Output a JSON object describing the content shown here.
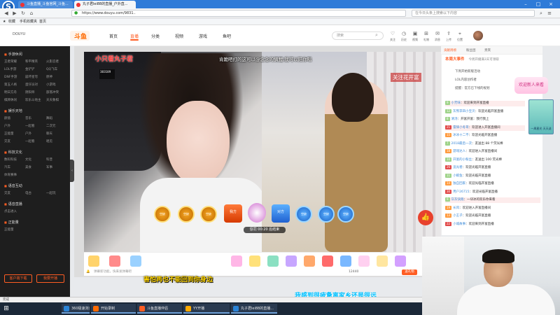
{
  "browser": {
    "tabs": [
      {
        "label": "斗鱼直播_斗鱼官网_斗鱼..."
      },
      {
        "label": "丸子君lei88的直播_户外直..."
      }
    ],
    "url": "https://www.douyu.com/9831..",
    "search_placeholder": "在今日头条上搜索以下内容",
    "window_controls": [
      "–",
      "□",
      "×"
    ]
  },
  "bookmarks": {
    "items": [
      "收藏",
      "手机收藏夹",
      "首页"
    ]
  },
  "site": {
    "logo": "斗鱼",
    "logo_mark": "DOUYU",
    "nav": [
      "首页",
      "直播",
      "分类",
      "视频",
      "游戏",
      "鱼吧"
    ],
    "active_nav": "直播",
    "search_placeholder": "搜索",
    "header_icons": [
      {
        "icon": "heart-icon",
        "label": "关注"
      },
      {
        "icon": "history-icon",
        "label": "历史"
      },
      {
        "icon": "video-icon",
        "label": "视频"
      },
      {
        "icon": "gift-icon",
        "label": "礼物"
      },
      {
        "icon": "bell-icon",
        "label": "消息"
      },
      {
        "icon": "upload-icon",
        "label": "上传"
      },
      {
        "icon": "location-icon",
        "label": "位置"
      }
    ]
  },
  "sidebar": {
    "sections": [
      {
        "title": "手游休闲",
        "rows": [
          [
            "王者荣耀",
            "和平精英",
            "火影忍者"
          ],
          [
            "LOL手游",
            "金铲铲",
            "QQ飞车"
          ],
          [
            "DNF手游",
            "崩坏星穹",
            "原神"
          ],
          [
            "第五人格",
            "蛋仔派对",
            "小游戏"
          ],
          [
            "明日方舟",
            "阴阳师",
            "部落冲突"
          ],
          [
            "棋牌休闲",
            "欢乐斗地主",
            "天天象棋"
          ]
        ]
      },
      {
        "title": "娱乐天地",
        "rows": [
          [
            "颜值",
            "音乐",
            "舞蹈"
          ],
          [
            "户外",
            "一起看",
            "二次元"
          ],
          [
            "正能量",
            "户外",
            "聊天"
          ],
          [
            "交友",
            "一起看",
            "唱见"
          ]
        ]
      },
      {
        "title": "科技文化",
        "rows": [
          [
            "数码科技",
            "文化",
            "科普"
          ],
          [
            "汽车",
            "美食",
            "军事"
          ],
          [
            "体育赛事",
            "",
            ""
          ]
        ]
      },
      {
        "title": "语音互动",
        "rows": [
          [
            "交友",
            "电台",
            "一起玩"
          ]
        ]
      },
      {
        "title": "语音直播",
        "rows": [
          [
            "点击进入",
            "",
            ""
          ]
        ]
      },
      {
        "title": "正能量",
        "rows": [
          [
            "正能量",
            "",
            ""
          ]
        ]
      }
    ],
    "btn_open": "客户端下载",
    "btn_apply": "我要开播"
  },
  "stream": {
    "streamer_name": "小只看丸子君",
    "room_id": "383189",
    "scroll_message": "肯跪吧打的这可以@念念的鲷鲤;我可以陪你唱",
    "follow_banner": "关注花开富",
    "pk_timer": "惩罚 00:20 后结束",
    "pk_labels": [
      "空缺",
      "空缺",
      "空缺",
      "我方",
      "对方",
      "空缺",
      "空缺",
      "空缺"
    ],
    "like_icon": "thumbs-up-icon",
    "chat_input": "弹幕新功能，快来发弹幕吧",
    "gift_count": "12440",
    "gift_label": "送礼物"
  },
  "subtitles": {
    "line1": "害怕再也不能回到你身边",
    "line2": "我感到很疲惫离家乡还是很远"
  },
  "chat": {
    "rank_tabs": [
      "贡献周榜",
      "粉丝团",
      "贵宾"
    ],
    "rank_title": "本周大事件",
    "rank_note": "今周开播满3天可领取",
    "notices": [
      "下周开始新版活动",
      "LOL内容创作者",
      "提醒：官方已下线的规划"
    ],
    "promo": "欢迎新人来看",
    "promo_side": "一周星光 天天送",
    "lines": [
      {
        "level": "9",
        "name": "小芳味",
        "text": "欢迎来到开富直播",
        "style": "pink"
      },
      {
        "level": "12",
        "name": "灰熊李四小宝贝",
        "text": "欢迎光临开富直播",
        "style": ""
      },
      {
        "level": "8",
        "name": "清汤",
        "text": "开富开富：我行我上",
        "style": ""
      },
      {
        "level": "21",
        "name": "雷锋小冬哥",
        "text": "欢迎进入开富直播间",
        "style": "pink"
      },
      {
        "level": "15",
        "name": "冰冰十二不",
        "text": "欢迎光临开富直播",
        "style": ""
      },
      {
        "level": "7",
        "name": "2018最后一次",
        "text": "友送出 88 个荧光棒",
        "style": ""
      },
      {
        "level": "18",
        "name": "游戏达人",
        "text": "欢迎进入开富直播间",
        "style": ""
      },
      {
        "level": "10",
        "name": "开富的小粉丝",
        "text": "友送出 100 荧光棒",
        "style": ""
      },
      {
        "level": "26",
        "name": "追光者",
        "text": "欢迎光临开富直播",
        "style": ""
      },
      {
        "level": "11",
        "name": "小鲸鱼",
        "text": "欢迎光临开富直播",
        "style": ""
      },
      {
        "level": "14",
        "name": "独自回家",
        "text": "欢迎光临开富直播",
        "style": ""
      },
      {
        "level": "30",
        "name": "用户26715",
        "text": "欢迎光临开富直播",
        "style": ""
      },
      {
        "level": "9",
        "name": "灰灰快跑",
        "text": "一块冰的欢乐你来看",
        "style": "pink"
      },
      {
        "level": "19",
        "name": "长风",
        "text": "欢迎进入开富直播间",
        "style": ""
      },
      {
        "level": "13",
        "name": "小王子",
        "text": "欢迎光临开富直播",
        "style": ""
      },
      {
        "level": "22",
        "name": "小城故事",
        "text": "欢迎来到开富直播",
        "style": ""
      }
    ]
  },
  "status": {
    "text": "完成"
  },
  "taskbar": {
    "items": [
      "360极速浏览",
      "开始录制",
      "斗鱼直播伴侣",
      "YY开播",
      "丸子君lei88的直播..."
    ],
    "colors": [
      "#2a83d6",
      "#ff6a00",
      "#ff5d23",
      "#ffaa00",
      "#2a83d6"
    ]
  },
  "colors": {
    "accent": "#ff5d23",
    "tabbar": "#2f7bd8",
    "taskbar": "#1b2838"
  }
}
